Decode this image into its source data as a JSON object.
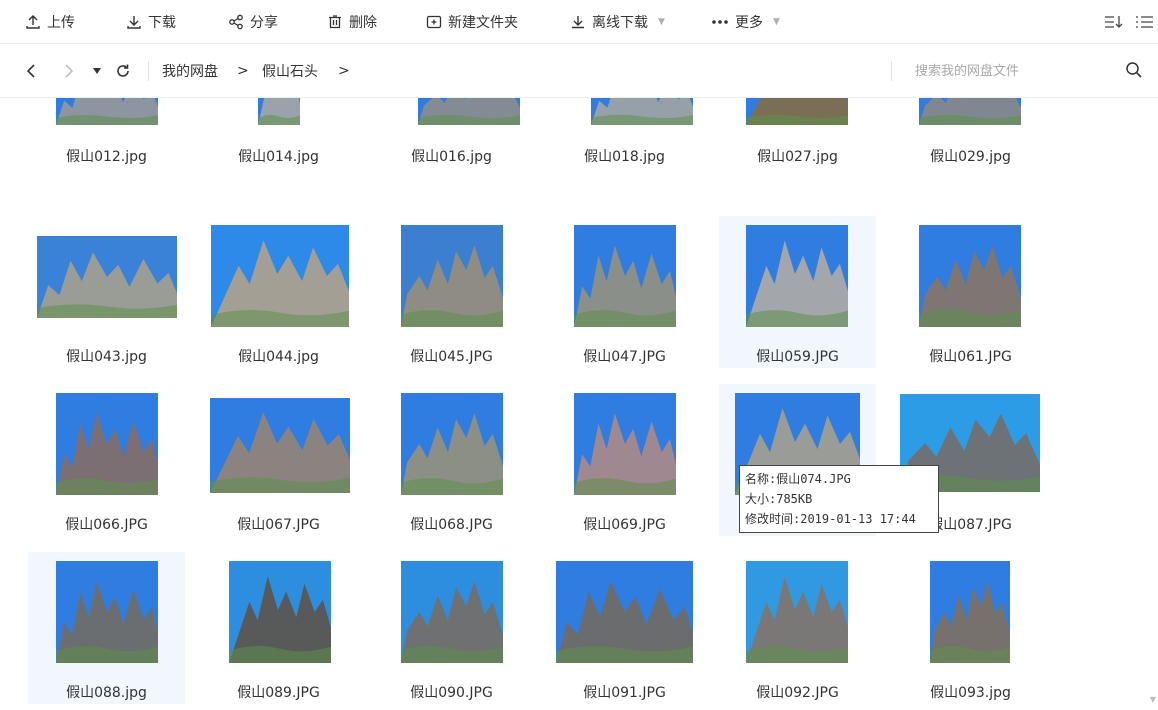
{
  "toolbar": {
    "upload": "上传",
    "download": "下载",
    "share": "分享",
    "delete": "删除",
    "new_folder": "新建文件夹",
    "offline_download": "离线下载",
    "more": "更多"
  },
  "nav": {
    "breadcrumb": [
      "我的网盘",
      "假山石头"
    ],
    "crumb_sep": ">",
    "search_placeholder": "搜索我的网盘文件"
  },
  "files": [
    {
      "name": "假山012.jpg",
      "sky": "#2f7de1",
      "rock": "#8d96a0"
    },
    {
      "name": "假山014.jpg",
      "sky": "#2f7de1",
      "rock": "#9aa3ab"
    },
    {
      "name": "假山016.jpg",
      "sky": "#2f7de1",
      "rock": "#838c95"
    },
    {
      "name": "假山018.jpg",
      "sky": "#2f7de1",
      "rock": "#96a0a8"
    },
    {
      "name": "假山027.jpg",
      "sky": "#2f7de1",
      "rock": "#7a6f55"
    },
    {
      "name": "假山029.jpg",
      "sky": "#2f7de1",
      "rock": "#7f8890"
    },
    {
      "name": "假山043.jpg",
      "sky": "#3a82d8",
      "rock": "#9a9c96"
    },
    {
      "name": "假山044.jpg",
      "sky": "#2d8ae8",
      "rock": "#a49f94"
    },
    {
      "name": "假山045.JPG",
      "sky": "#3b7fd0",
      "rock": "#8f8c84"
    },
    {
      "name": "假山047.JPG",
      "sky": "#2f7de1",
      "rock": "#8a8f8a"
    },
    {
      "name": "假山059.JPG",
      "sky": "#2f7de1",
      "rock": "#a3a6ab"
    },
    {
      "name": "假山061.JPG",
      "sky": "#2f7de1",
      "rock": "#7d7673"
    },
    {
      "name": "假山066.JPG",
      "sky": "#2f7de1",
      "rock": "#7c6f74"
    },
    {
      "name": "假山067.JPG",
      "sky": "#2f7de1",
      "rock": "#8b8380"
    },
    {
      "name": "假山068.JPG",
      "sky": "#2f7de1",
      "rock": "#8c8f86"
    },
    {
      "name": "假山069.JPG",
      "sky": "#2f7de1",
      "rock": "#a08890"
    },
    {
      "name": "假山074.JPG",
      "sky": "#2f7de1",
      "rock": "#9a9c98"
    },
    {
      "name": "假山087.JPG",
      "sky": "#2d9ce6",
      "rock": "#6d7277"
    },
    {
      "name": "假山088.jpg",
      "sky": "#2f7de1",
      "rock": "#6b6e70"
    },
    {
      "name": "假山089.JPG",
      "sky": "#2d8ee0",
      "rock": "#585a5a"
    },
    {
      "name": "假山090.JPG",
      "sky": "#2d8ee0",
      "rock": "#6e7072"
    },
    {
      "name": "假山091.JPG",
      "sky": "#2f7de1",
      "rock": "#6a6c6e"
    },
    {
      "name": "假山092.JPG",
      "sky": "#2f9ae2",
      "rock": "#7a7876"
    },
    {
      "name": "假山093.jpg",
      "sky": "#2f7de1",
      "rock": "#76716d"
    }
  ],
  "tooltip": {
    "name": "名称:假山074.JPG",
    "size": "大小:785KB",
    "modified": "修改时间:2019-01-13 17:44"
  },
  "colors": {
    "selected_bg": "#f1f7fd",
    "icon": "#333333"
  }
}
